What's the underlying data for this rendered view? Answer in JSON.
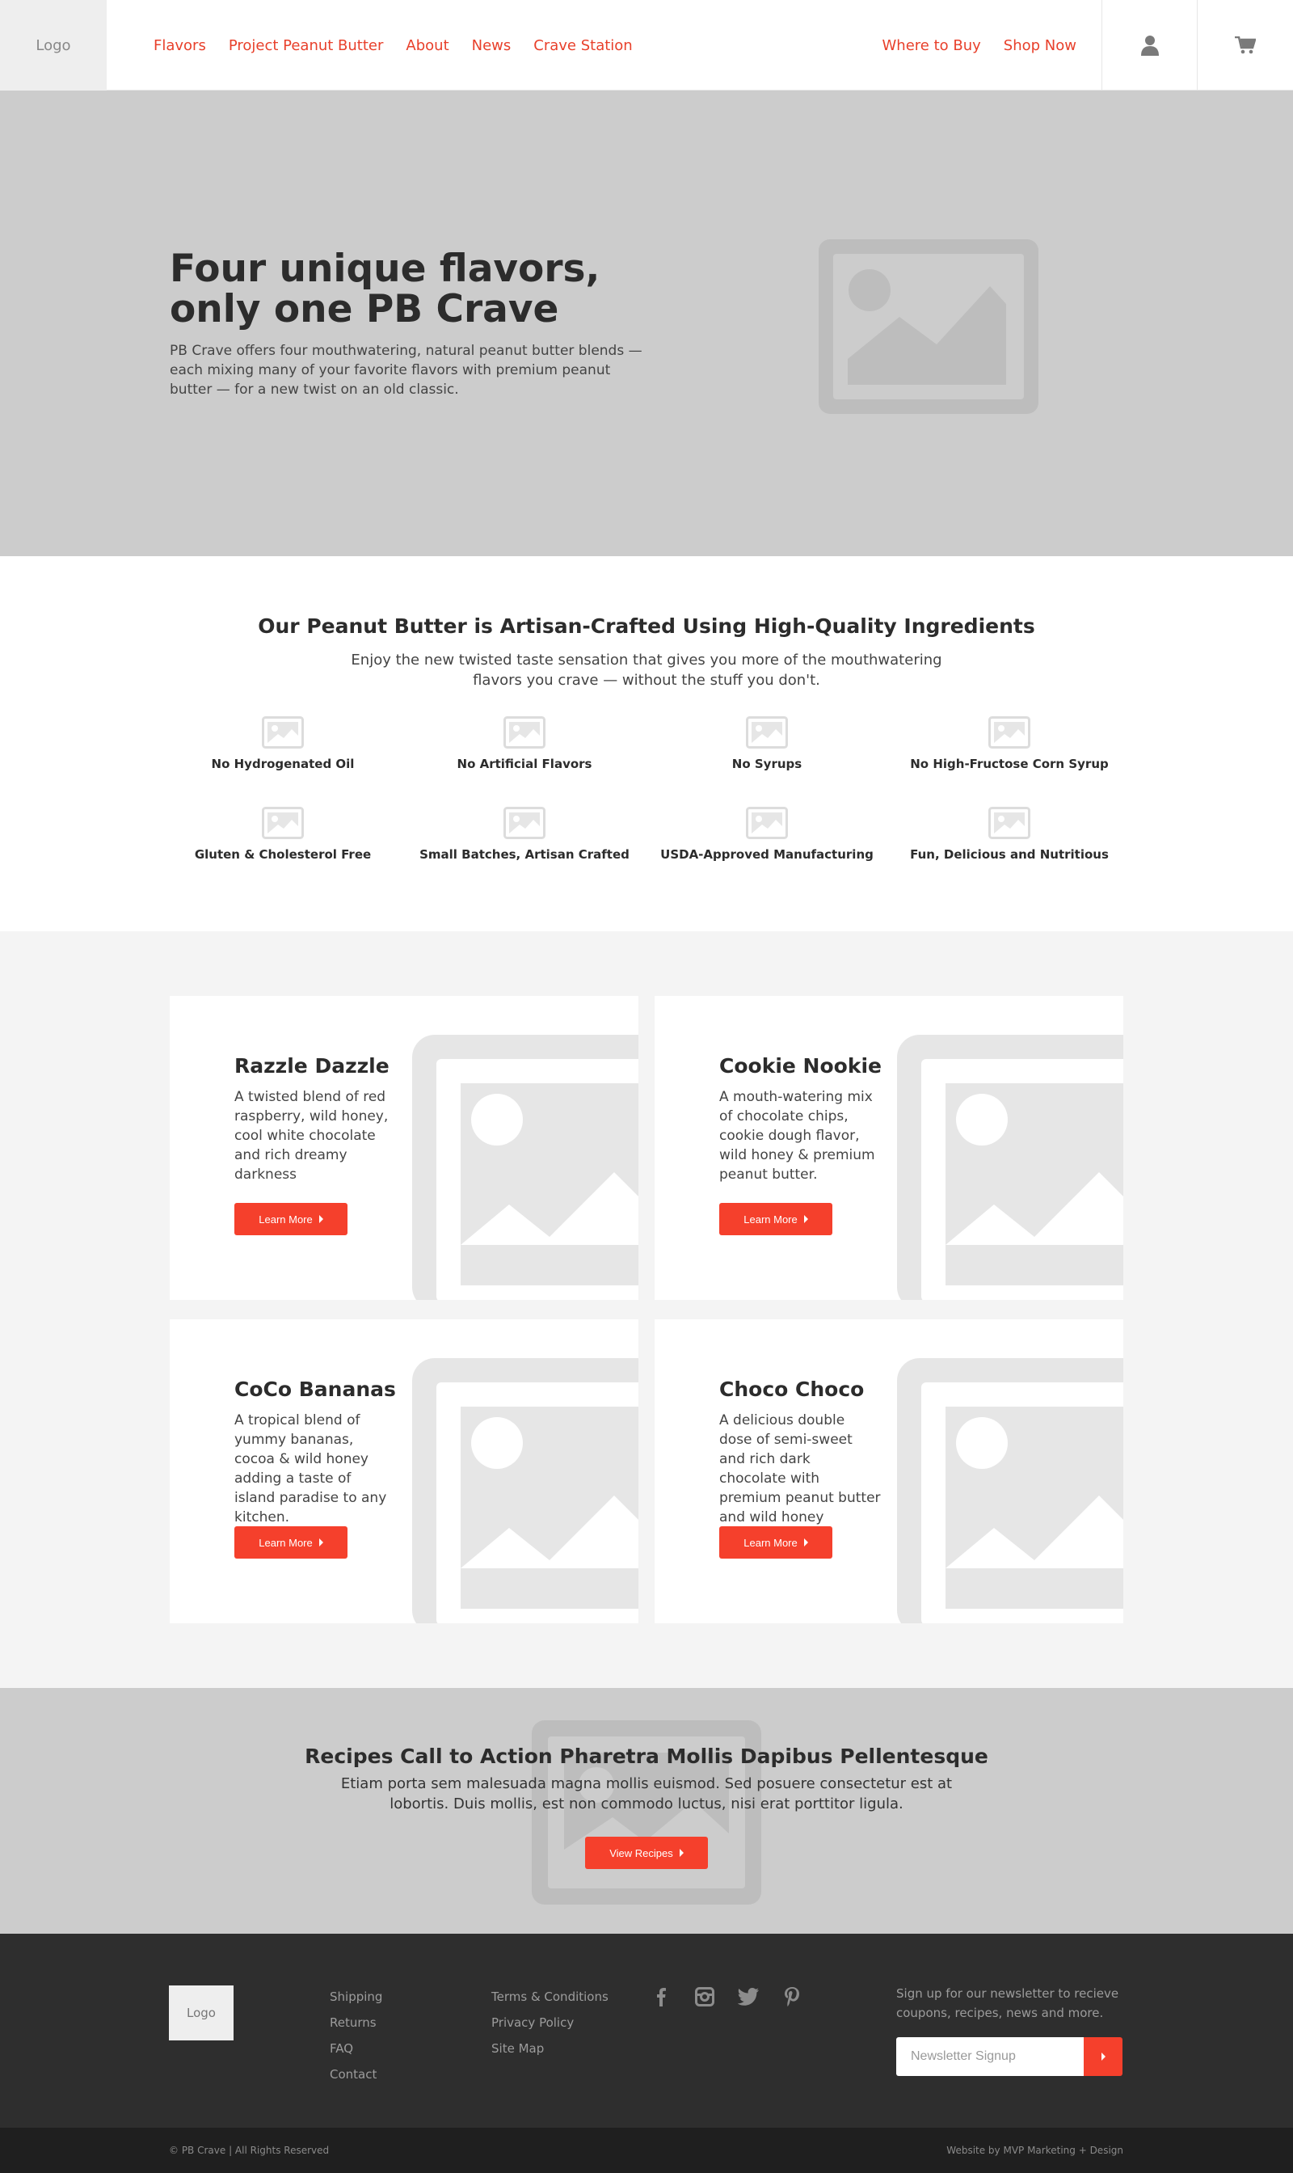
{
  "header": {
    "logo": "Logo",
    "nav_left": [
      "Flavors",
      "Project Peanut Butter",
      "About",
      "News",
      "Crave Station"
    ],
    "nav_right": [
      "Where to Buy",
      "Shop Now"
    ],
    "user_icon": "user-icon",
    "cart_icon": "cart-icon"
  },
  "hero": {
    "title": "Four unique flavors, only one PB Crave",
    "text": "PB Crave offers four mouthwatering, natural peanut butter blends — each mixing many of your favorite flavors with premium peanut butter — for a new twist on an old classic."
  },
  "features": {
    "title": "Our Peanut Butter is Artisan-Crafted Using High-Quality Ingredients",
    "subtitle": "Enjoy the new twisted taste sensation that gives you more of the mouthwatering flavors you crave — without the stuff you don't.",
    "items": [
      "No Hydrogenated Oil",
      "No Artificial Flavors",
      "No Syrups",
      "No High-Fructose Corn Syrup",
      "Gluten & Cholesterol Free",
      "Small Batches, Artisan Crafted",
      "USDA-Approved Manufacturing",
      "Fun, Delicious and Nutritious"
    ]
  },
  "flavors": [
    {
      "title": "Razzle Dazzle",
      "desc": "A twisted blend of red raspberry, wild honey, cool white chocolate and rich dreamy darkness",
      "button": "Learn More"
    },
    {
      "title": "Cookie Nookie",
      "desc": "A mouth-watering mix of chocolate chips, cookie dough flavor, wild honey & premium peanut butter.",
      "button": "Learn More"
    },
    {
      "title": "CoCo Bananas",
      "desc": "A tropical blend of yummy bananas, cocoa & wild honey adding a taste of island paradise to any kitchen.",
      "button": "Learn More"
    },
    {
      "title": "Choco Choco",
      "desc": "A delicious double dose of semi-sweet and rich dark chocolate with premium peanut butter and wild honey",
      "button": "Learn More"
    }
  ],
  "cta": {
    "title": "Recipes Call to Action Pharetra Mollis Dapibus Pellentesque",
    "text": "Etiam porta sem malesuada magna mollis euismod. Sed posuere consectetur est at lobortis. Duis mollis, est non commodo luctus, nisi erat porttitor ligula.",
    "button": "View Recipes"
  },
  "footer": {
    "logo": "Logo",
    "col1": [
      "Shipping",
      "Returns",
      "FAQ",
      "Contact"
    ],
    "col2": [
      "Terms & Conditions",
      "Privacy Policy",
      "Site Map"
    ],
    "social": [
      "facebook-icon",
      "instagram-icon",
      "twitter-icon",
      "pinterest-icon"
    ],
    "newsletter_text": "Sign up for our newsletter to recieve coupons, recipes, news and more.",
    "newsletter_placeholder": "Newsletter Signup",
    "copyright": "© PB Crave  |  All Rights Reserved",
    "credit": "Website by MVP Marketing + Design"
  },
  "colors": {
    "accent": "#f5402c",
    "nav_link": "#e8402b",
    "hero_bg": "#cccccc",
    "footer_bg": "#2e2e2e",
    "bottom_bar_bg": "#1f1f1f"
  }
}
